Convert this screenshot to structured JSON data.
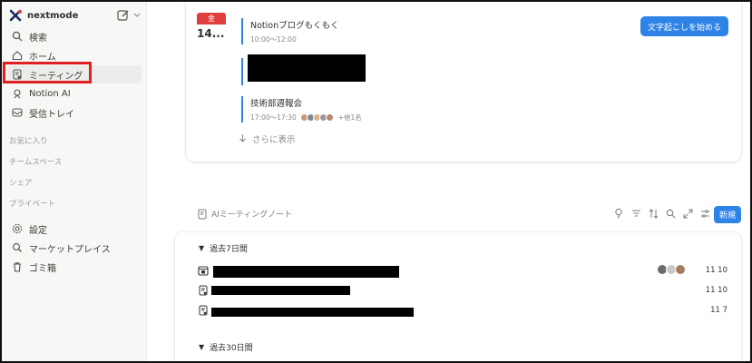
{
  "workspace": {
    "name": "nextmode"
  },
  "sidebar": {
    "items": [
      {
        "label": "検索"
      },
      {
        "label": "ホーム"
      },
      {
        "label": "ミーティング"
      },
      {
        "label": "Notion AI"
      },
      {
        "label": "受信トレイ"
      }
    ],
    "sections": [
      "お気に入り",
      "チームスペース",
      "シェア",
      "プライベート"
    ],
    "bottom_items": [
      {
        "label": "設定"
      },
      {
        "label": "マーケットプレイス"
      },
      {
        "label": "ゴミ箱"
      }
    ]
  },
  "calendar": {
    "day_of_week": "金",
    "day": "14...",
    "events": [
      {
        "title": "Notionブログもくもく",
        "time": "10:00～12:00"
      },
      {
        "title": "技術部週報会",
        "time": "17:00～17:30",
        "more": "+他1名"
      }
    ],
    "show_more": "さらに表示",
    "transcribe_button": "文字起こしを始める"
  },
  "notes": {
    "header": "AIミーティングノート",
    "new_button": "新規",
    "groups": [
      {
        "title": "過去7日間",
        "rows": [
          {
            "date": "11 10"
          },
          {
            "date": "11 10"
          },
          {
            "date": "11 7"
          }
        ]
      },
      {
        "title": "過去30日間",
        "rows": []
      }
    ]
  },
  "colors": {
    "accent": "#2e83e6",
    "calendar_red": "#e03e3e",
    "highlight": "#e02020",
    "sidebar_bg": "#f7f7f5"
  },
  "icons": {
    "logo": "notion-x-logo-icon",
    "edit": "edit-icon",
    "search": "search-icon",
    "home": "home-icon",
    "meeting": "meeting-notes-icon",
    "ai": "notion-ai-icon",
    "inbox": "inbox-icon",
    "settings": "gear-icon",
    "marketplace": "marketplace-icon",
    "trash": "trash-icon"
  }
}
